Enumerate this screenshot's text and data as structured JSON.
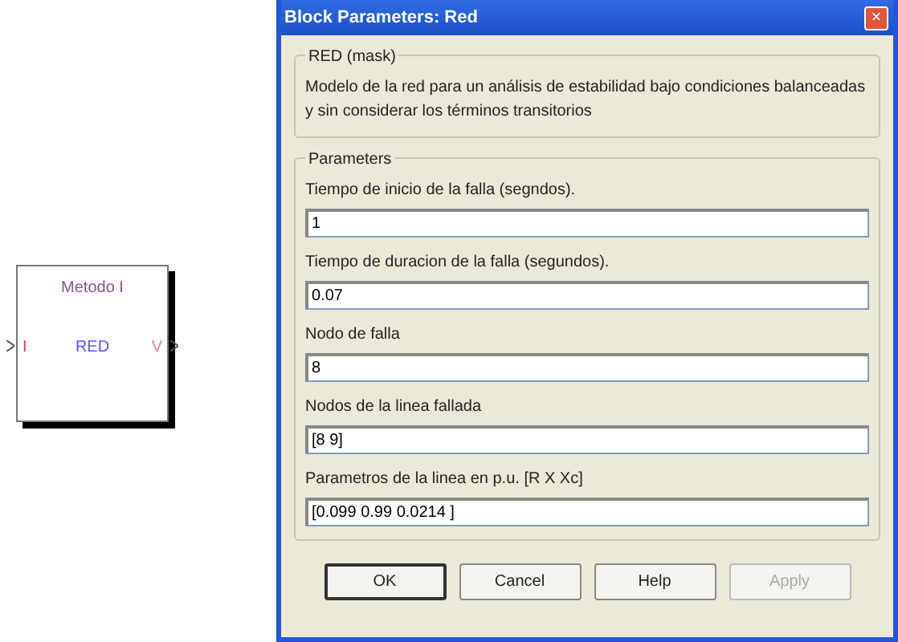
{
  "block": {
    "title": "Metodo I",
    "name": "RED",
    "input_port": "I",
    "output_port": "V"
  },
  "dialog": {
    "title": "Block Parameters: Red",
    "close": "×",
    "mask_group": "RED (mask)",
    "description": "Modelo de la red para un análisis de estabilidad bajo condiciones balanceadas y sin considerar los términos transitorios",
    "params_group": "Parameters",
    "params": [
      {
        "label": "Tiempo de inicio de la falla (segndos).",
        "value": "1"
      },
      {
        "label": "Tiempo de duracion de la falla (segundos).",
        "value": "0.07"
      },
      {
        "label": "Nodo de falla",
        "value": "8"
      },
      {
        "label": "Nodos de la linea fallada",
        "value": "[8 9]"
      },
      {
        "label": "Parametros de la linea en p.u. [R  X  Xc]",
        "value": "[0.099 0.99 0.0214 ]"
      }
    ],
    "buttons": [
      {
        "label": "OK",
        "default": true,
        "disabled": false
      },
      {
        "label": "Cancel",
        "default": false,
        "disabled": false
      },
      {
        "label": "Help",
        "default": false,
        "disabled": false
      },
      {
        "label": "Apply",
        "default": false,
        "disabled": true
      }
    ]
  }
}
